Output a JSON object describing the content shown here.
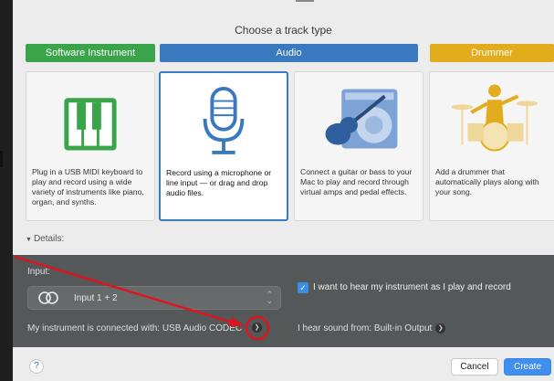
{
  "dialog": {
    "title": "Choose a track type"
  },
  "categories": [
    {
      "label": "Software Instrument",
      "color": "#3aa44a"
    },
    {
      "label": "Audio",
      "color": "#3a78c0"
    },
    {
      "label": "Drummer",
      "color": "#e2ac1d"
    }
  ],
  "cards": [
    {
      "id": "software-instrument",
      "icon": "piano-keyboard-icon",
      "desc": "Plug in a USB MIDI keyboard to play and record using a wide variety of instruments like piano, organ, and synths.",
      "selected": false
    },
    {
      "id": "microphone",
      "icon": "microphone-icon",
      "desc": "Record using a microphone or line input — or drag and drop audio files.",
      "selected": true
    },
    {
      "id": "guitar",
      "icon": "guitar-amp-icon",
      "desc": "Connect a guitar or bass to your Mac to play and record through virtual amps and pedal effects.",
      "selected": false
    },
    {
      "id": "drummer",
      "icon": "drummer-icon",
      "desc": "Add a drummer that automatically plays along with your song.",
      "selected": false
    }
  ],
  "details": {
    "label": "Details:"
  },
  "input": {
    "label": "Input:",
    "value": "Input 1 + 2"
  },
  "monitor": {
    "label": "I want to hear my instrument as I play and record",
    "checked": true
  },
  "connected": {
    "label": "My instrument is connected with: USB Audio CODEC"
  },
  "sound": {
    "label": "I hear sound from: Built-in Output"
  },
  "buttons": {
    "help": "?",
    "cancel": "Cancel",
    "create": "Create"
  },
  "colors": {
    "accent": "#3a78c0",
    "annotation": "#e0141e"
  }
}
